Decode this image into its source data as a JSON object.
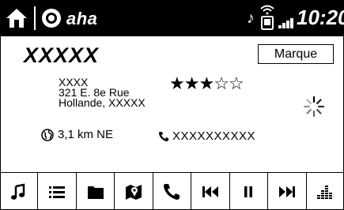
{
  "status_bar": {
    "app_name": "aha",
    "time": "10:20",
    "icons": [
      "home-icon",
      "aha-logo-icon",
      "music-note-icon",
      "phone-wifi-icon",
      "signal-strength-icon"
    ]
  },
  "station": {
    "title": "XXXXX",
    "marque_label": "Marque",
    "address_lines": [
      "XXXX",
      "321 E. 8e Rue",
      "Hollande, XXXXX"
    ],
    "rating": {
      "value": 3,
      "max": 5
    },
    "distance": "3,1 km NE",
    "phone": "XXXXXXXXXX",
    "loading": true
  },
  "toolbar": {
    "buttons": [
      "music-icon",
      "list-icon",
      "folder-icon",
      "map-icon",
      "call-icon",
      "previous-icon",
      "pause-icon",
      "next-icon",
      "equalizer-icon"
    ]
  }
}
